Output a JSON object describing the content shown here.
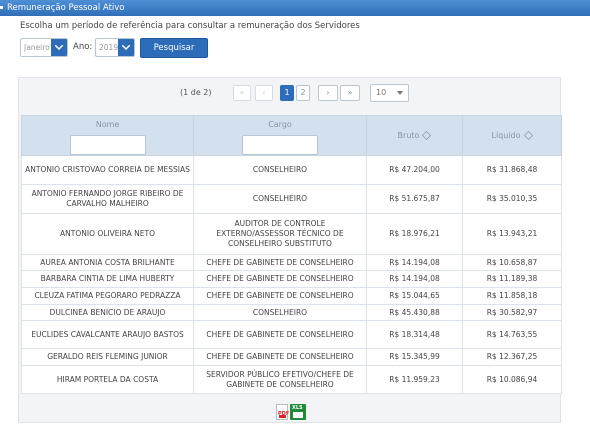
{
  "window": {
    "title": "Remuneração Pessoal Ativo"
  },
  "filters": {
    "intro": "Escolha um período de referência para consultar a remuneração dos Servidores",
    "month_value": "Janeiro",
    "year_label": "Ano:",
    "year_value": "2019",
    "search_label": "Pesquisar"
  },
  "pager": {
    "info": "(1 de 2)",
    "first": "«",
    "prev": "‹",
    "pages": [
      "1",
      "2"
    ],
    "next": "›",
    "last": "»",
    "rows_per_page": "10"
  },
  "table": {
    "headers": [
      "Nome",
      "Cargo",
      "Bruto",
      "Líquido"
    ],
    "rows": [
      [
        "ANTONIO CRISTOVAO CORREIA DE MESSIAS",
        "CONSELHEIRO",
        "R$ 47.204,00",
        "R$ 31.868,48"
      ],
      [
        "ANTONIO FERNANDO JORGE RIBEIRO DE CARVALHO MALHEIRO",
        "CONSELHEIRO",
        "R$ 51.675,87",
        "R$ 35.010,35"
      ],
      [
        "ANTONIO OLIVEIRA NETO",
        "AUDITOR DE CONTROLE EXTERNO/ASSESSOR TÉCNICO DE CONSELHEIRO SUBSTITUTO",
        "R$ 18.976,21",
        "R$ 13.943,21"
      ],
      [
        "AUREA ANTONIA COSTA BRILHANTE",
        "CHEFE DE GABINETE DE CONSELHEIRO",
        "R$ 14.194,08",
        "R$ 10.658,87"
      ],
      [
        "BARBARA CINTIA DE LIMA HUBERTY",
        "CHEFE DE GABINETE DE CONSELHEIRO",
        "R$ 14.194,08",
        "R$ 11.189,38"
      ],
      [
        "CLEUZA FATIMA PEGORARO PEDRAZZA",
        "CHEFE DE GABINETE DE CONSELHEIRO",
        "R$ 15.044,65",
        "R$ 11.858,18"
      ],
      [
        "DULCINEA BENICIO DE ARAUJO",
        "CONSELHEIRO",
        "R$ 45.430,88",
        "R$ 30.582,97"
      ],
      [
        "EUCLIDES CAVALCANTE ARAUJO BASTOS",
        "CHEFE DE GABINETE DE CONSELHEIRO",
        "R$ 18.314,48",
        "R$ 14.763,55"
      ],
      [
        "GERALDO REIS FLEMING JUNIOR",
        "CHEFE DE GABINETE DE CONSELHEIRO",
        "R$ 15.345,99",
        "R$ 12.367,25"
      ],
      [
        "HIRAM PORTELA DA COSTA",
        "SERVIDOR PÚBLICO EFETIVO/CHEFE DE GABINETE DE CONSELHEIRO",
        "R$ 11.959,23",
        "R$ 10.086,94"
      ]
    ]
  },
  "exports": {
    "pdf_text": "PDF",
    "xls_text": "XLS"
  }
}
